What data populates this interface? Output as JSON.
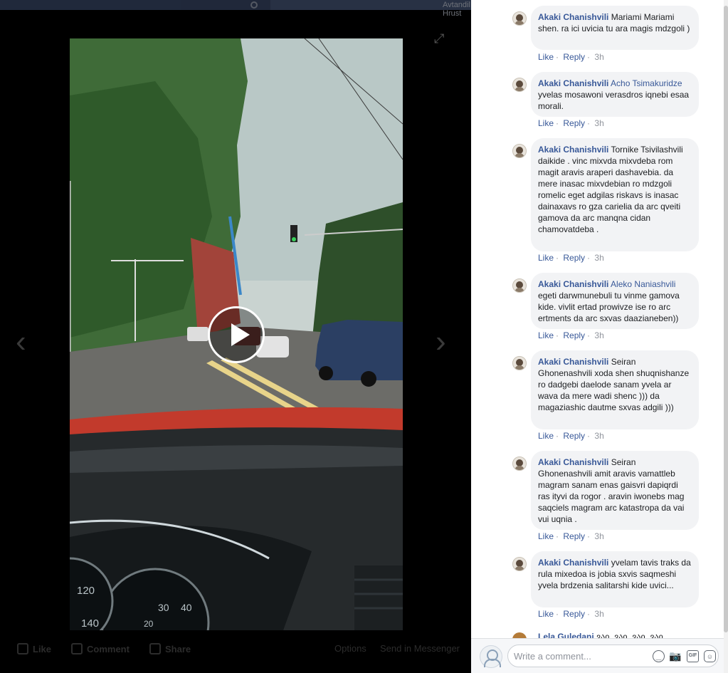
{
  "header": {
    "user_name": "Avtandil Hrust"
  },
  "video": {
    "play_label": "Play video"
  },
  "actions": {
    "like": "Like",
    "comment": "Comment",
    "share": "Share",
    "options": "Options",
    "send": "Send in Messenger"
  },
  "comments": [
    {
      "author": "Akaki Chanishvili",
      "mention": "",
      "text": "Mariami Mariami shen. ra ici uvicia tu ara magis mdzgoli )",
      "like": "Like",
      "reply": "Reply",
      "time": "3h"
    },
    {
      "author": "Akaki Chanishvili",
      "mention": "Acho Tsimakuridze",
      "text": "yvelas mosawoni verasdros iqnebi esaa morali.",
      "like": "Like",
      "reply": "Reply",
      "time": "3h"
    },
    {
      "author": "Akaki Chanishvili",
      "mention": "",
      "text": "Tornike Tsivilashvili daikide . vinc mixvda mixvdeba rom magit aravis araperi dashavebia. da mere inasac mixvdebian ro mdzgoli romelic eget adgilas riskavs is inasac dainaxavs ro gza carielia da arc qveiti gamova da arc manqna cidan chamovatdeba .",
      "like": "Like",
      "reply": "Reply",
      "time": "3h"
    },
    {
      "author": "Akaki Chanishvili",
      "mention": "Aleko Naniashvili",
      "text": "egeti darwmunebuli tu vinme gamova kide. vivlit ertad prowivze ise ro arc ertments da arc sxvas daazianeben))",
      "like": "Like",
      "reply": "Reply",
      "time": "3h"
    },
    {
      "author": "Akaki Chanishvili",
      "mention": "",
      "text": "Seiran Ghonenashvili xoda shen shuqnishanze ro dadgebi daelode sanam yvela ar wava da mere wadi shenc ))) da magaziashic dautme sxvas adgili )))",
      "like": "Like",
      "reply": "Reply",
      "time": "3h"
    },
    {
      "author": "Akaki Chanishvili",
      "mention": "",
      "text": "Seiran Ghonenashvili amit aravis vamattleb magram sanam enas gaisvri dapiqrdi ras ityvi da rogor . aravin iwonebs mag saqciels magram arc katastropa da vai vui uqnia .",
      "like": "Like",
      "reply": "Reply",
      "time": "3h"
    },
    {
      "author": "Akaki Chanishvili",
      "mention": "",
      "text": "yvelam tavis traks da rula mixedoa is jobia sxvis saqmeshi yvela brdzenia salitarshi kide uvici...",
      "like": "Like",
      "reply": "Reply",
      "time": "3h"
    }
  ],
  "partial_comment": {
    "author": "Lela Guledani",
    "text": "ვაი, ვაი, ვაი, ვაი"
  },
  "composer": {
    "placeholder": "Write a comment..."
  }
}
